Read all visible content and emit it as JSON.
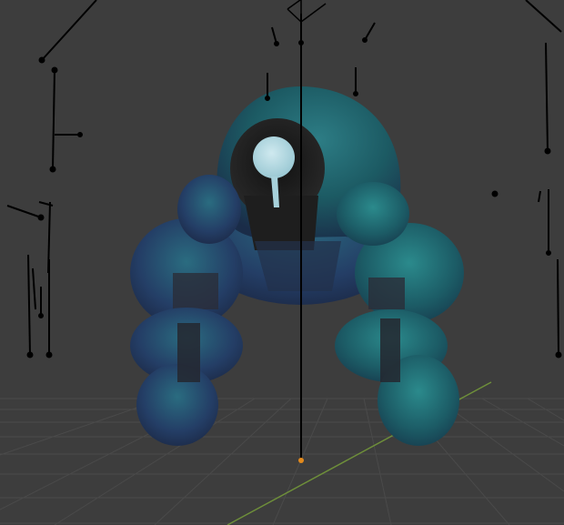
{
  "viewport": {
    "mode": "3D Viewport",
    "shading": "rendered",
    "background_color": "#3d3d3d",
    "grid_color": "#4a4a4a",
    "axis_y_color": "#6e8f3a",
    "armature_color": "#000000",
    "origin_color": "#e38a1c"
  },
  "objects": [
    {
      "name": "character-mesh",
      "type": "mesh",
      "material_color": "#1e5f66",
      "secondary_color": "#2a3550"
    },
    {
      "name": "armature",
      "type": "armature"
    },
    {
      "name": "camera",
      "type": "camera"
    }
  ]
}
